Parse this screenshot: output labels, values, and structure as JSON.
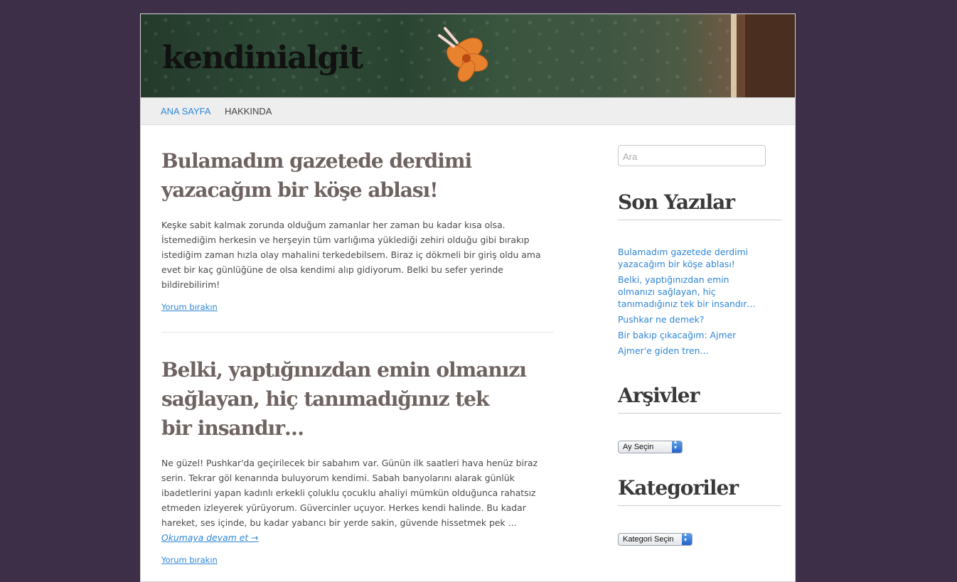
{
  "site": {
    "title": "kendinialgit"
  },
  "nav": {
    "items": [
      {
        "label": "ANA SAYFA"
      },
      {
        "label": "HAKKINDA"
      }
    ]
  },
  "posts": [
    {
      "title_line1": "Bulamadım gazetede derdimi",
      "title_line2": "yazacağım bir köşe ablası!",
      "excerpt": "Keşke sabit kalmak zorunda olduğum zamanlar her zaman bu kadar kısa olsa. İstemediğim herkesin ve herşeyin tüm varlığıma yüklediği zehiri olduğu gibi bırakıp istediğim zaman hızla olay mahalini terkedebilsem. Biraz iç dökmeli bir giriş oldu ama evet bir kaç günlüğüne de olsa kendimi alıp gidiyorum. Belki bu sefer yerinde bildirebilirim!",
      "comment_link": "Yorum bırakın"
    },
    {
      "title_line1": "Belki, yaptığınızdan emin olmanızı",
      "title_line2": "sağlayan, hiç tanımadığınız tek",
      "title_line3": "bir insandır…",
      "excerpt": "Ne güzel! Pushkar'da geçirilecek bir sabahım var. Günün ilk saatleri hava henüz biraz serin. Tekrar göl kenarında buluyorum kendimi. Sabah banyolarını alarak günlük ibadetlerini yapan kadınlı erkekli çoluklu çocuklu ahaliyi mümkün olduğunca rahatsız etmeden izleyerek yürüyorum. Güvercinler uçuyor. Herkes kendi halinde. Bu kadar hareket, ses içinde, bu kadar yabancı bir yerde sakin, güvende hissetmek pek …",
      "more_link": "Okumaya devam et →",
      "comment_link": "Yorum bırakın"
    }
  ],
  "sidebar": {
    "search_placeholder": "Ara",
    "recent_title": "Son Yazılar",
    "recent_items": [
      "Bulamadım gazetede derdimi yazacağım bir köşe ablası!",
      "Belki, yaptığınızdan emin olmanızı sağlayan, hiç tanımadığınız tek bir insandır…",
      "Pushkar ne demek?",
      "Bir bakıp çıkacağım: Ajmer",
      "Ajmer'e giden tren…"
    ],
    "archives_title": "Arşivler",
    "archives_select": "Ay Seçin",
    "categories_title": "Kategoriler",
    "categories_select": "Kategori Seçin"
  }
}
